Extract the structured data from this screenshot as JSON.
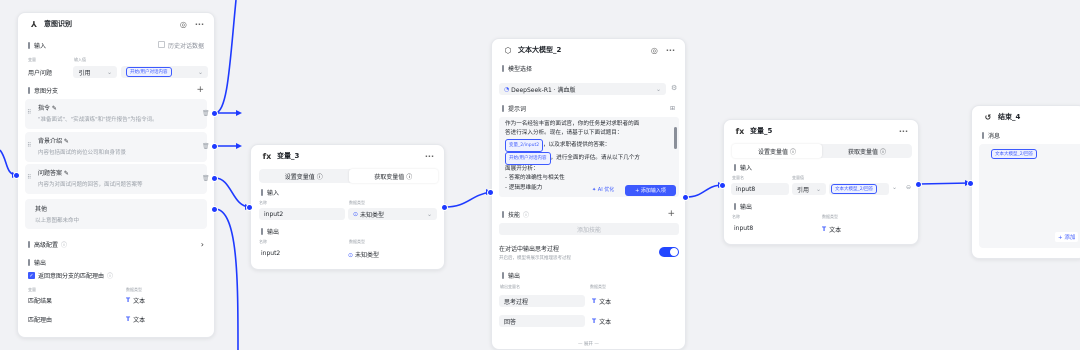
{
  "intent": {
    "title": "意图识别",
    "input_section": "输入",
    "history_checkbox": "历史对话数据",
    "col_name": "变量",
    "col_type": "输入值",
    "var_name": "用户问题",
    "ref_mode": "引用",
    "ref_value": "开始/用户对话内容",
    "branch_section": "意图分支",
    "branches": [
      {
        "title": "指令",
        "desc": "\"准备面试\"、\"实战演练\"和\"提升报告\"为指令词。"
      },
      {
        "title": "背景介绍",
        "desc": "内容包括面试的岗位公司和自身背景"
      },
      {
        "title": "问题答案",
        "desc": "内容为对面试问题的回答，面试问题答案等"
      }
    ],
    "other_title": "其他",
    "other_desc": "以上意图都未命中",
    "advanced_section": "高级配置",
    "output_section": "输出",
    "output_checkbox": "返回意图分支的匹配理由",
    "out_col_name": "变量",
    "out_col_type": "数据类型",
    "outputs": [
      {
        "name": "匹配结果",
        "type": "文本"
      },
      {
        "name": "匹配理由",
        "type": "文本"
      }
    ]
  },
  "var3": {
    "title": "变量_3",
    "tab_set": "设置变量值",
    "tab_get": "获取变量值",
    "input_section": "输入",
    "col_name": "名称",
    "col_type": "数据类型",
    "input_name": "input2",
    "input_type": "未知类型",
    "output_section": "输出",
    "output_name": "input2",
    "output_type": "未知类型"
  },
  "llm": {
    "title": "文本大模型_2",
    "model_section": "模型选择",
    "model_value": "DeepSeek-R1 · 满血版",
    "prompt_section": "提示词",
    "prompt_lines": [
      "作为一名经验丰富的面试官，你的任务是对求职者的面",
      "答进行深入分析。现在，请基于以下面试题目：",
      "，以及求职者提供的答案：",
      "，进行全面的评估。请从以下几个方",
      "面展开分析：",
      "- 答案的准确性与相关性",
      "- 逻辑思维能力"
    ],
    "prompt_tag_1": "变量_2/input2",
    "prompt_tag_2": "开始/用户对话内容",
    "ai_opt": "AI 优化",
    "add_input": "添加输入项",
    "skill_section": "技能",
    "skill_placeholder": "添加技能",
    "think_label": "在对话中输出思考过程",
    "think_desc": "开启后，模型将展示其推理思考过程",
    "output_section": "输出",
    "col_name": "输出变量名",
    "col_type": "数据类型",
    "outputs": [
      {
        "name": "思考过程",
        "type": "文本"
      },
      {
        "name": "回答",
        "type": "文本"
      }
    ],
    "more": "— 展开 —"
  },
  "var5": {
    "title": "变量_5",
    "tab_set": "设置变量值",
    "tab_get": "获取变量值",
    "input_section": "输入",
    "col_name": "变量名",
    "col_type": "变量值",
    "input_name": "input8",
    "ref_mode": "引用",
    "ref_value": "文本大模型_2/回答",
    "output_section": "输出",
    "out_col_name": "名称",
    "out_col_type": "数据类型",
    "output_name": "input8",
    "output_type": "文本"
  },
  "end": {
    "title": "结束_4",
    "section": "消息",
    "tag": "文本大模型_2/回答",
    "add_btn": "+ 添加"
  },
  "colors": {
    "accent": "#3d5afe",
    "edge": "#1e3aff"
  }
}
